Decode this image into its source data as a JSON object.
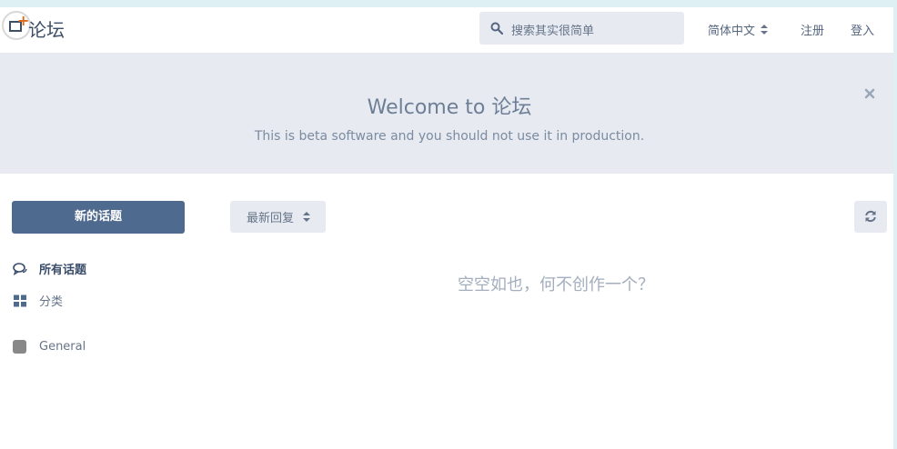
{
  "header": {
    "site_title": "论坛",
    "search_placeholder": "搜索其实很简单",
    "language": "简体中文",
    "signup": "注册",
    "login": "登入"
  },
  "hero": {
    "title": "Welcome to 论坛",
    "subtitle": "This is beta software and you should not use it in production."
  },
  "sidebar": {
    "new_topic": "新的话题",
    "items": [
      {
        "label": "所有话题",
        "icon": "comments-icon"
      },
      {
        "label": "分类",
        "icon": "grid-icon"
      }
    ],
    "tags": [
      {
        "label": "General",
        "color": "#888888"
      }
    ]
  },
  "toolbar": {
    "sort_label": "最新回复"
  },
  "main": {
    "empty_message": "空空如也，何不创作一个？"
  },
  "colors": {
    "primary": "#4f6a8f",
    "hero_bg": "#e7ebf1"
  }
}
